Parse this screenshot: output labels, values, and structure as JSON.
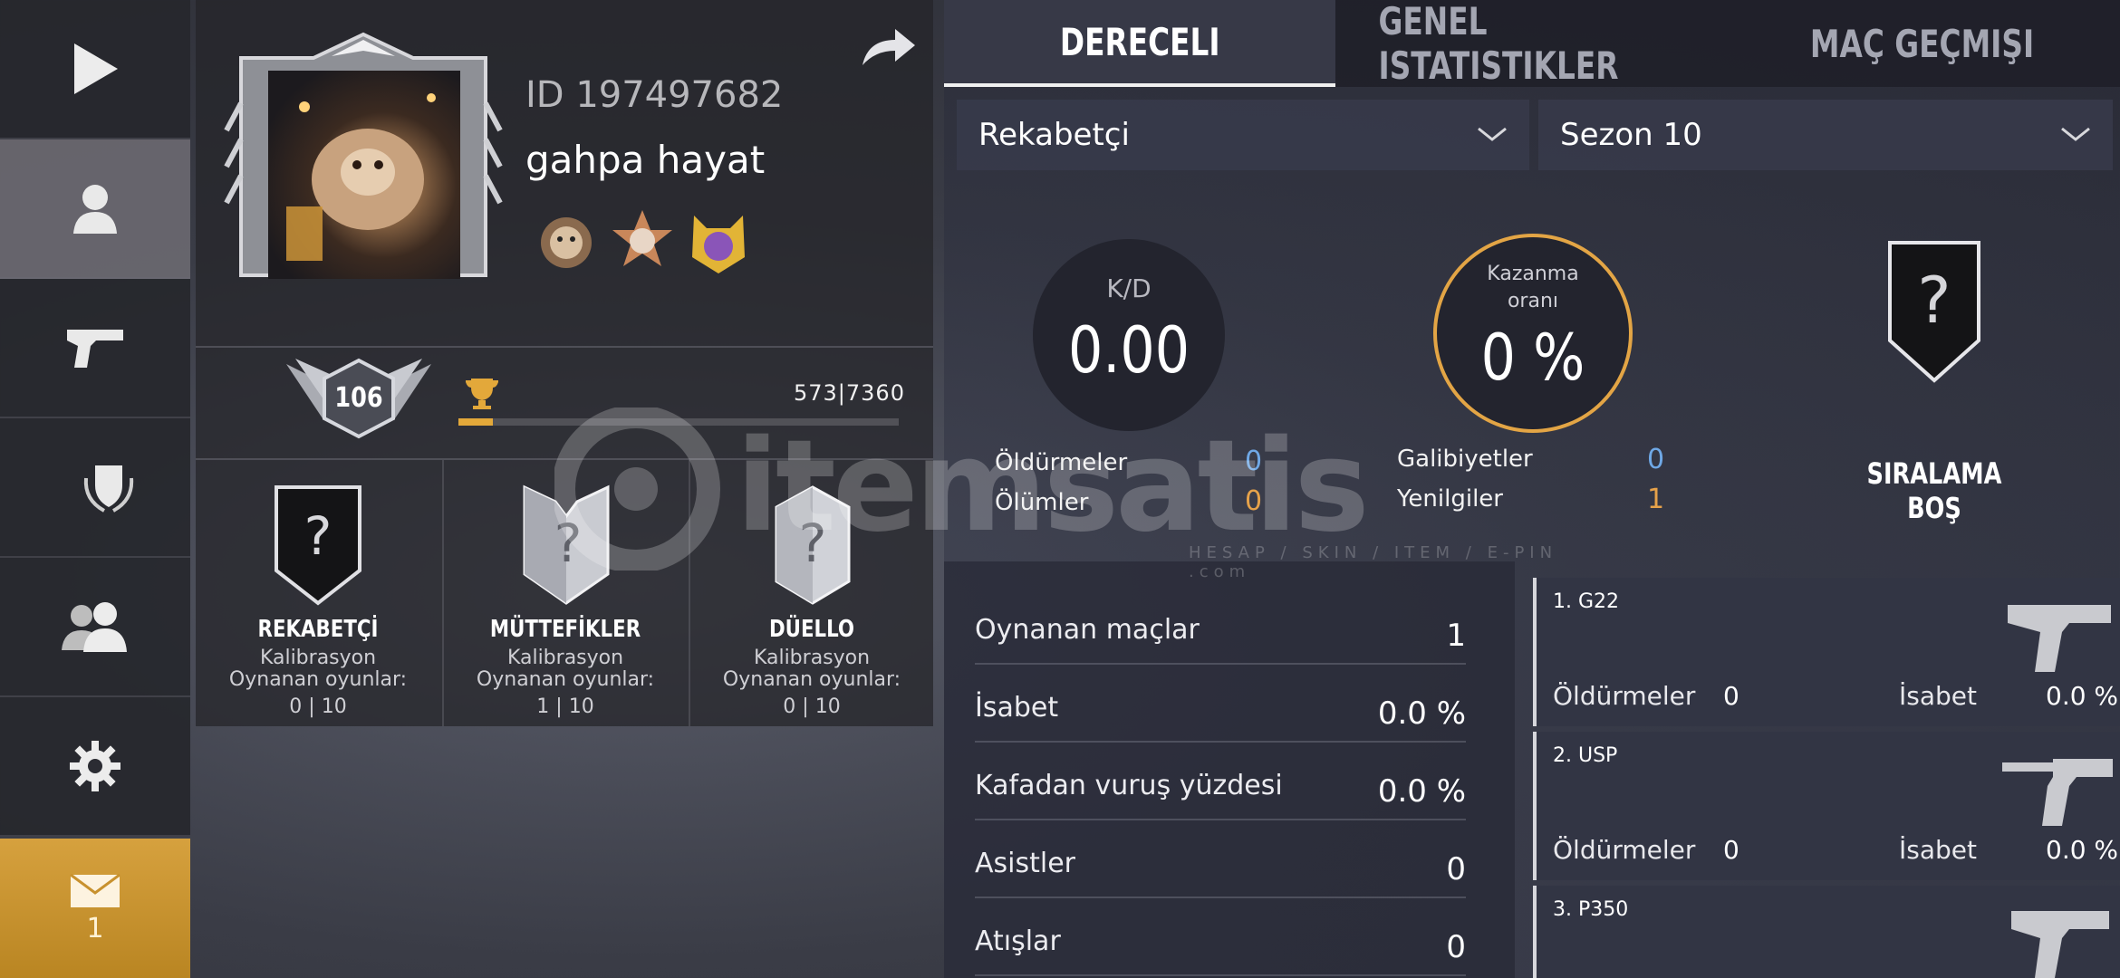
{
  "sidebar": {
    "items": [
      {
        "name": "play",
        "icon": "play-icon"
      },
      {
        "name": "profile",
        "icon": "person-icon"
      },
      {
        "name": "weapons",
        "icon": "pistol-icon"
      },
      {
        "name": "clan",
        "icon": "shield-wreath-icon"
      },
      {
        "name": "friends",
        "icon": "friends-icon"
      },
      {
        "name": "settings",
        "icon": "gear-icon"
      },
      {
        "name": "mail",
        "icon": "envelope-icon"
      }
    ],
    "mail_count": "1"
  },
  "profile": {
    "player_id": "ID 197497682",
    "player_name": "gahpa hayat",
    "level": "106",
    "xp": "573|7360",
    "xp_progress": 0.078,
    "badges": [
      "monkey-badge-icon",
      "medal-2025-badge-icon",
      "cat-2025-badge-icon"
    ],
    "modes": [
      {
        "title": "REKABETÇİ",
        "status": "Kalibrasyon",
        "played_label": "Oynanan oyunlar:",
        "played": "0 | 10"
      },
      {
        "title": "MÜTTEFİKLER",
        "status": "Kalibrasyon",
        "played_label": "Oynanan oyunlar:",
        "played": "1 | 10"
      },
      {
        "title": "DÜELLO",
        "status": "Kalibrasyon",
        "played_label": "Oynanan oyunlar:",
        "played": "0 | 10"
      }
    ]
  },
  "tabs": [
    "DERECELI",
    "GENEL ISTATISTIKLER",
    "MAÇ GEÇMIŞI"
  ],
  "active_tab": 0,
  "filters": {
    "mode": "Rekabetçi",
    "season": "Sezon 10"
  },
  "summary": {
    "kd_label": "K/D",
    "kd_value": "0.00",
    "win_label_1": "Kazanma",
    "win_label_2": "oranı",
    "win_value": "0 %",
    "kills_label": "Öldürmeler",
    "kills_value": "0",
    "deaths_label": "Ölümler",
    "deaths_value": "0",
    "wins_label": "Galibiyetler",
    "wins_value": "0",
    "losses_label": "Yenilgiler",
    "losses_value": "1",
    "rank_text": "SIRALAMA BOŞ"
  },
  "details": [
    {
      "label": "Oynanan maçlar",
      "value": "1"
    },
    {
      "label": "İsabet",
      "value": "0.0 %"
    },
    {
      "label": "Kafadan vuruş yüzdesi",
      "value": "0.0 %"
    },
    {
      "label": "Asistler",
      "value": "0"
    },
    {
      "label": "Atışlar",
      "value": "0"
    }
  ],
  "weapons": [
    {
      "name": "1. G22",
      "kills_label": "Öldürmeler",
      "kills": "0",
      "acc_label": "İsabet",
      "acc": "0.0 %",
      "icon": "pistol-g22-icon"
    },
    {
      "name": "2. USP",
      "kills_label": "Öldürmeler",
      "kills": "0",
      "acc_label": "İsabet",
      "acc": "0.0 %",
      "icon": "pistol-usp-icon"
    },
    {
      "name": "3. P350",
      "icon": "pistol-p350-icon"
    }
  ],
  "watermark": {
    "text": "itemsatis",
    "sub": "HESAP / SKIN / ITEM / E-PIN .com"
  },
  "colors": {
    "accent": "#e3a545",
    "stat_blue": "#6fa8e6",
    "stat_orange": "#e6a24a",
    "mail_bg": "#d6a13e"
  }
}
